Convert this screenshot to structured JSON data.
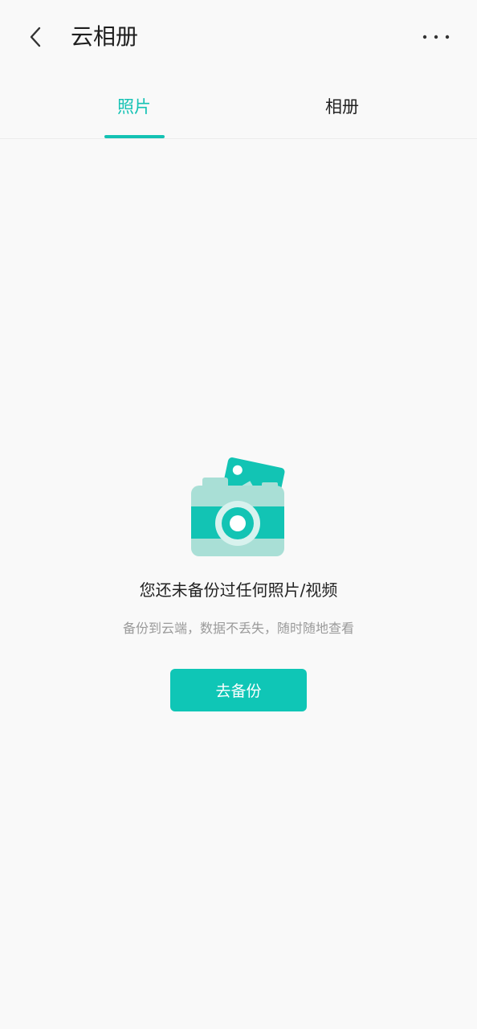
{
  "header": {
    "title": "云相册",
    "back_icon": "chevron-left-icon",
    "more_icon": "more-horizontal-icon"
  },
  "tabs": [
    {
      "label": "照片",
      "active": true
    },
    {
      "label": "相册",
      "active": false
    }
  ],
  "empty_state": {
    "title": "您还未备份过任何照片/视频",
    "subtitle": "备份到云端，数据不丢失，随时随地查看",
    "button_label": "去备份",
    "illustration_icon": "camera-photo-icon"
  },
  "colors": {
    "accent": "#14c2b4",
    "button": "#0fc6b6",
    "background": "#f9f9f9",
    "subtitle": "#9a9a9a"
  }
}
